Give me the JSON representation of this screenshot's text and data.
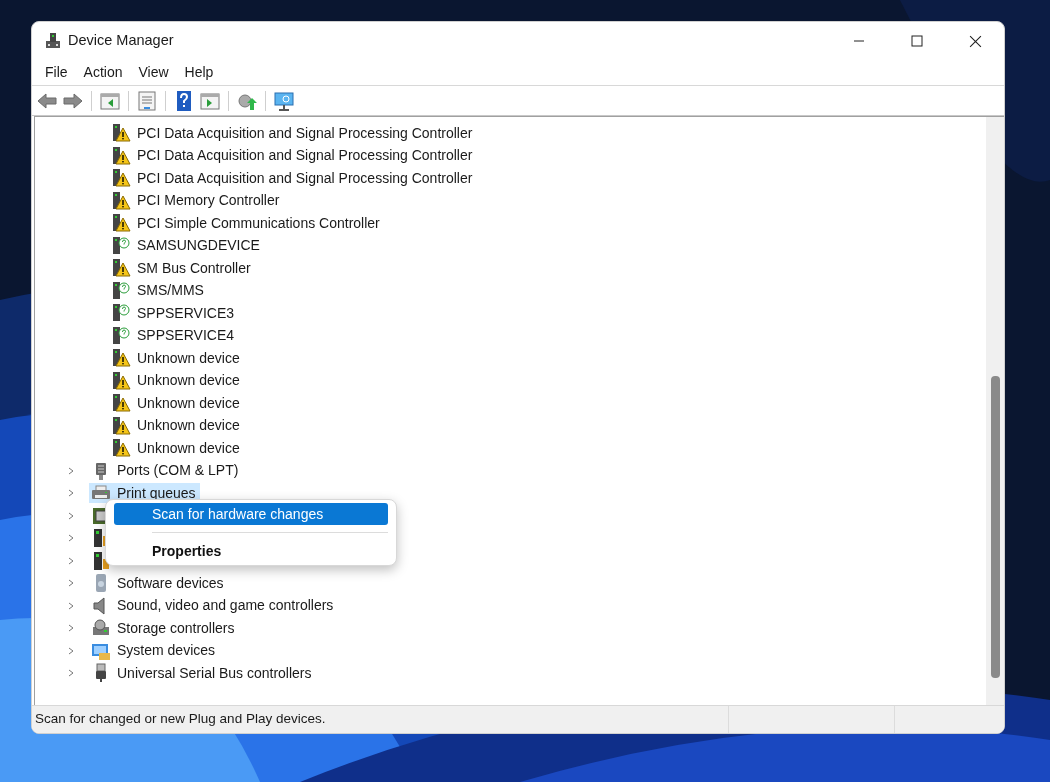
{
  "window": {
    "title": "Device Manager"
  },
  "menu": [
    "File",
    "Action",
    "View",
    "Help"
  ],
  "toolbar": [
    {
      "kind": "back"
    },
    {
      "kind": "forward"
    },
    {
      "kind": "sep"
    },
    {
      "kind": "tree"
    },
    {
      "kind": "sep"
    },
    {
      "kind": "properties"
    },
    {
      "kind": "sep"
    },
    {
      "kind": "help"
    },
    {
      "kind": "action"
    },
    {
      "kind": "sep"
    },
    {
      "kind": "update"
    },
    {
      "kind": "sep"
    },
    {
      "kind": "scan"
    }
  ],
  "tree": {
    "visible_children": [
      {
        "label": "PCI Data Acquisition and Signal Processing Controller",
        "kind": "warning"
      },
      {
        "label": "PCI Data Acquisition and Signal Processing Controller",
        "kind": "warning"
      },
      {
        "label": "PCI Data Acquisition and Signal Processing Controller",
        "kind": "warning"
      },
      {
        "label": "PCI Memory Controller",
        "kind": "warning"
      },
      {
        "label": "PCI Simple Communications Controller",
        "kind": "warning"
      },
      {
        "label": "SAMSUNGDEVICE",
        "kind": "unknown"
      },
      {
        "label": "SM Bus Controller",
        "kind": "warning"
      },
      {
        "label": "SMS/MMS",
        "kind": "unknown"
      },
      {
        "label": "SPPSERVICE3",
        "kind": "unknown"
      },
      {
        "label": "SPPSERVICE4",
        "kind": "unknown"
      },
      {
        "label": "Unknown device",
        "kind": "warning"
      },
      {
        "label": "Unknown device",
        "kind": "warning"
      },
      {
        "label": "Unknown device",
        "kind": "warning"
      },
      {
        "label": "Unknown device",
        "kind": "warning"
      },
      {
        "label": "Unknown device",
        "kind": "warning"
      }
    ],
    "categories": [
      {
        "label": "Ports (COM & LPT)",
        "kind": "port",
        "selected": false
      },
      {
        "label": "Print queues",
        "kind": "printer",
        "selected": true
      },
      {
        "kind": "chip",
        "selected": false
      },
      {
        "kind": "tower",
        "selected": false
      },
      {
        "kind": "tower",
        "selected": false
      },
      {
        "label": "Software devices",
        "kind": "software",
        "selected": false
      },
      {
        "label": "Sound, video and game controllers",
        "kind": "sound",
        "selected": false
      },
      {
        "label": "Storage controllers",
        "kind": "storage",
        "selected": false
      },
      {
        "label": "System devices",
        "kind": "system",
        "selected": false
      },
      {
        "label": "Universal Serial Bus controllers",
        "kind": "usb",
        "selected": false
      }
    ]
  },
  "context_menu": [
    {
      "label": "Scan for hardware changes",
      "kind": "item",
      "selected": true,
      "bold": false
    },
    {
      "kind": "separator"
    },
    {
      "label": "Properties",
      "kind": "item",
      "selected": false,
      "bold": true
    }
  ],
  "status_bar": {
    "text": "Scan for changed or new Plug and Play devices."
  }
}
